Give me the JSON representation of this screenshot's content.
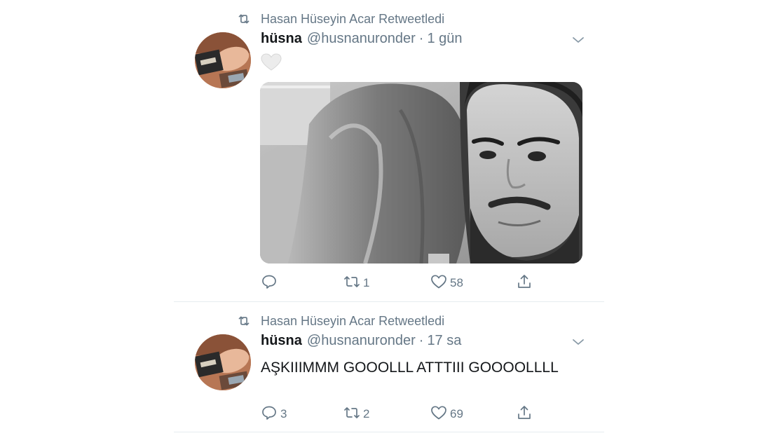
{
  "tweets": [
    {
      "retweeted_by": "Hasan Hüseyin Acar Retweetledi",
      "name": "hüsna",
      "handle": "@husnanuronder",
      "separator": "·",
      "time": "1 gün",
      "emoji": "white-heart",
      "has_photo": true,
      "actions": {
        "reply": "",
        "retweet": "1",
        "like": "58"
      }
    },
    {
      "retweeted_by": "Hasan Hüseyin Acar Retweetledi",
      "name": "hüsna",
      "handle": "@husnanuronder",
      "separator": "·",
      "time": "17 sa",
      "text": "AŞKIIIMMM GOOOLLL ATTTIII GOOOOLLLL",
      "actions": {
        "reply": "3",
        "retweet": "2",
        "like": "69"
      }
    }
  ],
  "icons": {
    "retweet": "retweet-icon",
    "reply": "reply-icon",
    "like": "heart-icon",
    "share": "share-icon",
    "more": "chevron-down-icon"
  },
  "colors": {
    "text": "#14171a",
    "secondary": "#657786",
    "divider": "#e6ecf0",
    "background": "#ffffff"
  }
}
